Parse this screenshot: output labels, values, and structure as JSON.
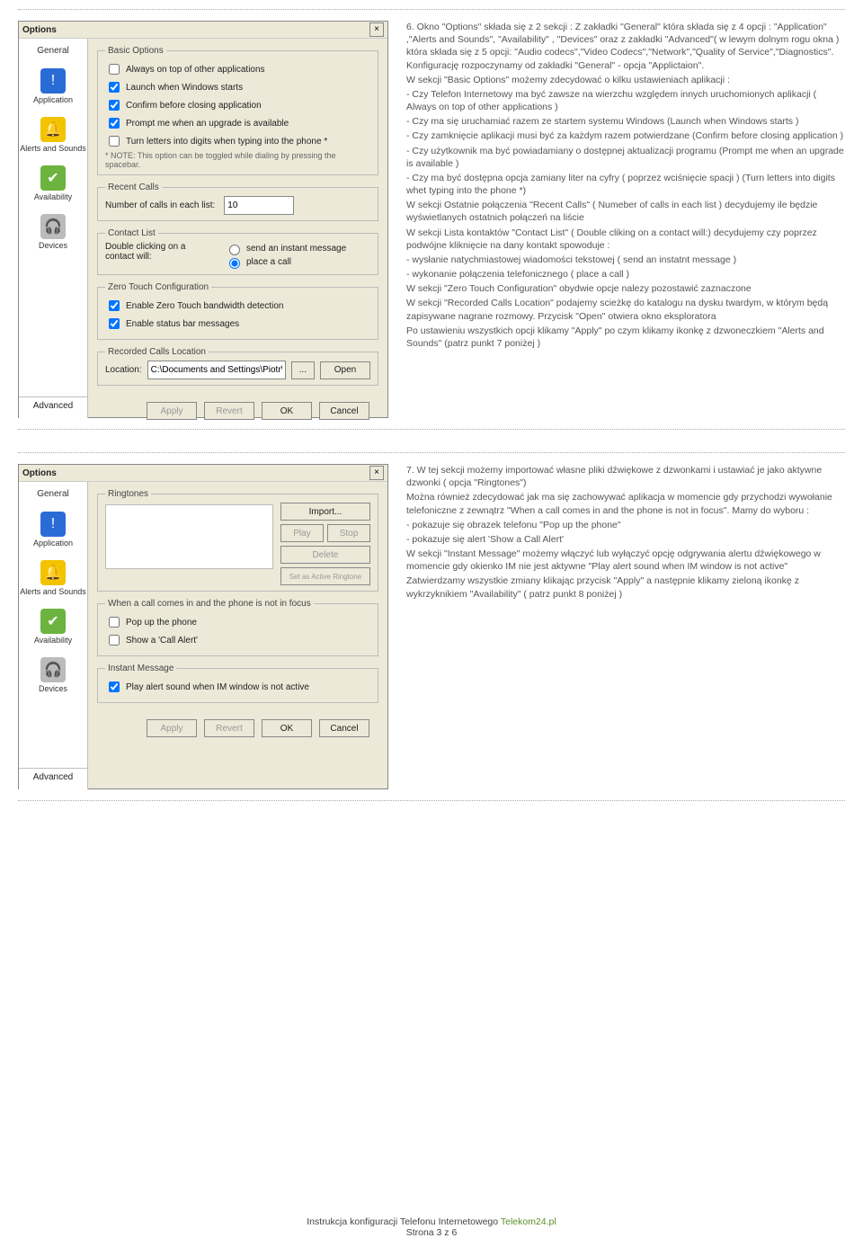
{
  "section6": {
    "paragraphs": [
      "6. Okno \"Options\" składa się z 2 sekcji : Z zakładki \"General\" która składa się z 4 opcji : \"Application\" ,\"Alerts and Sounds\", \"Availability\" , \"Devices\" oraz z zakładki \"Advanced\"( w lewym dolnym rogu okna ) która składa się z 5 opcji: \"Audio codecs\",\"Video Codecs\",\"Network\",\"Quality of Service\",\"Diagnostics\". Konfigurację rozpoczynamy od zakładki \"General\" - opcja \"Applictaion\".",
      "W sekcji \"Basic Options\" możemy zdecydować o kilku ustawieniach aplikacji :",
      "- Czy Telefon Internetowy ma być zawsze na wierzchu względem innych uruchomionych aplikacji ( Always on top of other applications )",
      "- Czy ma się uruchamiać razem ze startem systemu Windows (Launch when Windows starts )",
      "- Czy zamknięcie aplikacji musi być za każdym razem potwierdzane (Confirm before closing application )",
      "- Czy użytkownik ma być powiadamiany o dostępnej aktualizacji programu (Prompt me when an upgrade is available )",
      "- Czy ma być dostępna opcja zamiany liter na cyfry ( poprzez wciśnięcie spacji ) (Turn letters into digits whet typing into the phone *)",
      "W sekcji Ostatnie połączenia \"Recent Calls\" ( Numeber of calls in each list ) decydujemy ile będzie wyświetlanych ostatnich połączeń na liście",
      "W sekcji Lista kontaktów \"Contact List\" ( Double cliking on a contact will:) decydujemy czy poprzez podwójne kliknięcie na dany kontakt spowoduje :",
      "- wysłanie natychmiastowej wiadomości tekstowej ( send an instatnt message )",
      "- wykonanie połączenia telefonicznego ( place a call )",
      "W sekcji \"Zero Touch Configuration\" obydwie opcje nalezy pozostawić zaznaczone",
      "W sekcji \"Recorded Calls Location\" podajemy scieżkę do katalogu na dysku twardym, w którym będą zapisywane nagrane rozmowy. Przycisk \"Open\" otwiera okno eksploratora",
      "Po ustawieniu wszystkich opcji klikamy \"Apply\" po czym klikamy ikonkę z dzwoneczkiem \"Alerts and Sounds\" (patrz punkt 7 poniżej )"
    ]
  },
  "section7": {
    "paragraphs": [
      "7. W tej sekcji możemy importować własne pliki dźwiękowe z dzwonkami i ustawiać je jako aktywne dzwonki ( opcja \"Ringtones\")",
      "Można również zdecydować jak ma się zachowywać aplikacja w momencie gdy przychodzi wywołanie telefoniczne z zewnątrz \"When a call comes in and the phone is not in focus\". Mamy do wyboru :",
      "- pokazuje się obrazek telefonu \"Pop up the phone\"",
      "- pokazuje się alert 'Show a Call Alert'",
      "W sekcji \"Instant Message\" możemy włączyć lub wyłączyć opcję odgrywania alertu dźwiękowego w momencie gdy okienko IM nie jest aktywne \"Play alert sound when IM window is not active\"",
      "Zatwierdzamy wszystkie zmiany klikając przycisk \"Apply\" a następnie klikamy zieloną ikonkę z wykrzyknikiem \"Availability\" ( patrz punkt 8 poniżej )"
    ]
  },
  "win1": {
    "title": "Options",
    "sidebar": {
      "general": "General",
      "app": "Application",
      "alerts": "Alerts and Sounds",
      "avail": "Availability",
      "dev": "Devices",
      "adv": "Advanced"
    },
    "groups": {
      "basic": {
        "legend": "Basic Options",
        "opt1": "Always on top of other applications",
        "opt2": "Launch when Windows starts",
        "opt3": "Confirm before closing application",
        "opt4": "Prompt me when an upgrade is available",
        "opt5": "Turn letters into digits when typing into the phone *",
        "note": "* NOTE: This option can be toggled while dialing by pressing the spacebar."
      },
      "recent": {
        "legend": "Recent Calls",
        "label": "Number of calls in each list:",
        "value": "10"
      },
      "contact": {
        "legend": "Contact List",
        "label": "Double clicking on a contact will:",
        "r1": "send an instant message",
        "r2": "place a call"
      },
      "zero": {
        "legend": "Zero Touch Configuration",
        "z1": "Enable Zero Touch bandwidth detection",
        "z2": "Enable status bar messages"
      },
      "loc": {
        "legend": "Recorded Calls Location",
        "label": "Location:",
        "value": "C:\\Documents and Settings\\Piotr\\Moje dokum",
        "browse": "...",
        "open": "Open"
      }
    },
    "buttons": {
      "apply": "Apply",
      "revert": "Revert",
      "ok": "OK",
      "cancel": "Cancel"
    }
  },
  "win2": {
    "title": "Options",
    "sidebar": {
      "general": "General",
      "app": "Application",
      "alerts": "Alerts and Sounds",
      "avail": "Availability",
      "dev": "Devices",
      "adv": "Advanced"
    },
    "ring": {
      "legend": "Ringtones",
      "import": "Import...",
      "play": "Play",
      "stop": "Stop",
      "del": "Delete",
      "set": "Set as Active Ringtone"
    },
    "focus": {
      "legend": "When a call comes in and the phone is not in focus",
      "f1": "Pop up the phone",
      "f2": "Show a 'Call Alert'"
    },
    "im": {
      "legend": "Instant Message",
      "i1": "Play alert sound when IM window is not active"
    },
    "buttons": {
      "apply": "Apply",
      "revert": "Revert",
      "ok": "OK",
      "cancel": "Cancel"
    }
  },
  "footer": {
    "left": "Instrukcja konfiguracji Telefonu Internetowego",
    "brand": "Telekom24.pl",
    "page": "Strona 3 z 6"
  }
}
